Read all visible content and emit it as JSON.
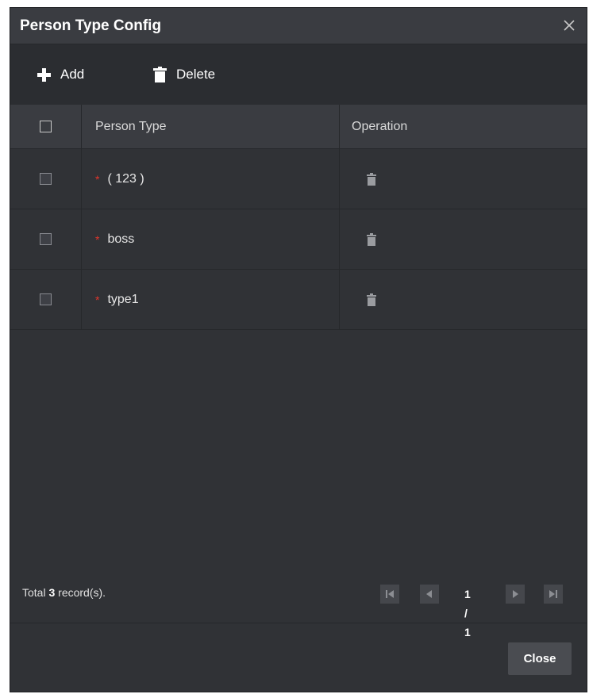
{
  "window": {
    "title": "Person Type Config"
  },
  "toolbar": {
    "add_label": "Add",
    "delete_label": "Delete"
  },
  "table": {
    "columns": [
      "Person Type",
      "Operation"
    ],
    "rows": [
      {
        "type": "( 123 )",
        "required_mark": "*"
      },
      {
        "type": "boss",
        "required_mark": "*"
      },
      {
        "type": "type1",
        "required_mark": "*"
      }
    ]
  },
  "footer": {
    "total_prefix": "Total ",
    "total_count": "3",
    "total_suffix": " record(s).",
    "page_indicator": "1 / 1"
  },
  "buttons": {
    "close_label": "Close"
  },
  "icons": [
    "close-icon",
    "plus-icon",
    "trash-icon",
    "first-page-icon",
    "prev-page-icon",
    "next-page-icon",
    "last-page-icon"
  ],
  "colors": {
    "required": "#e0362c",
    "background": "#303236",
    "header": "#3a3c41"
  }
}
